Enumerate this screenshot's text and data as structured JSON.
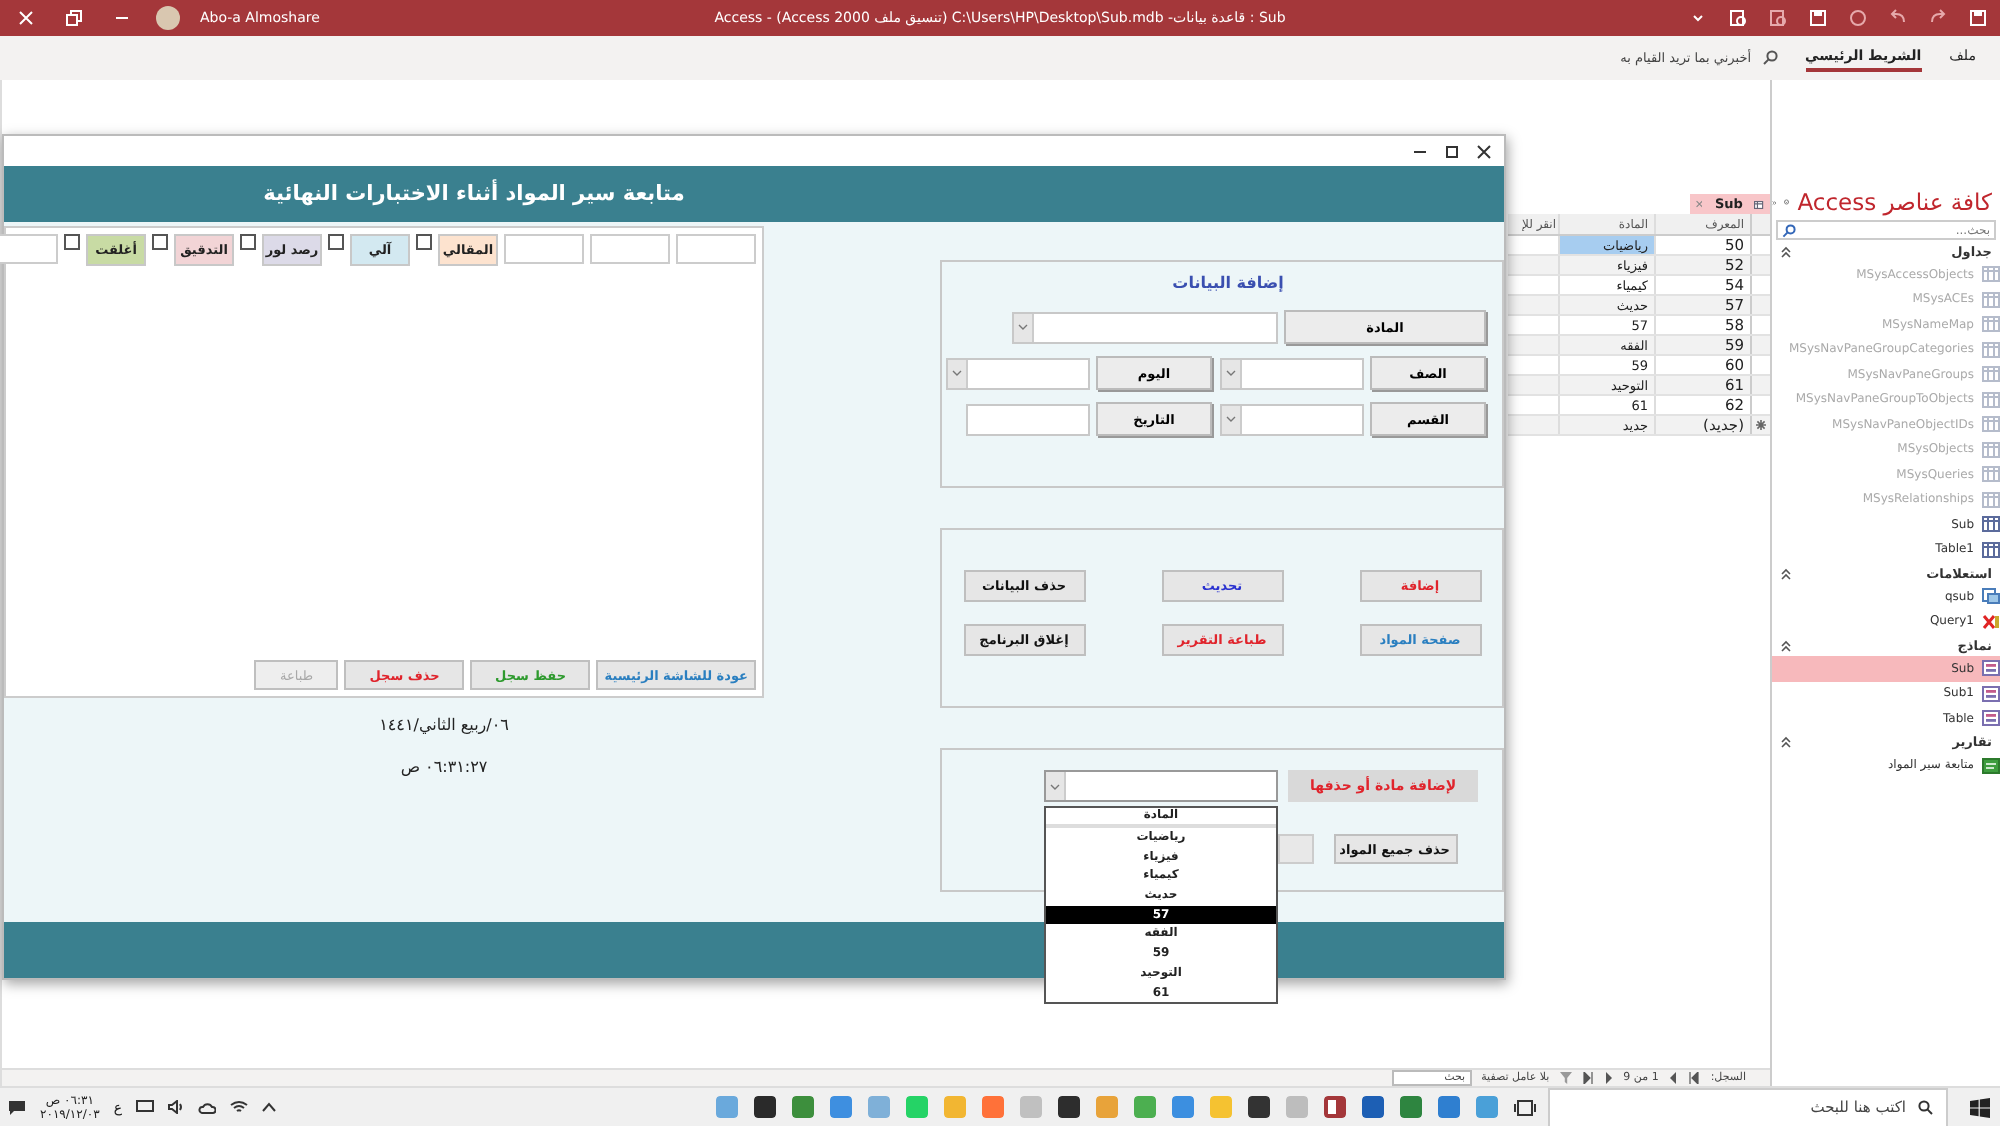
{
  "window": {
    "title": "Sub : قاعدة بيانات- C:\\Users\\HP\\Desktop\\Sub.mdb (تنسيق ملف Access 2000) - Access",
    "user": "Abo-a Almoshare"
  },
  "ribbon": {
    "tabs": [
      {
        "label": "ملف",
        "selected": false
      },
      {
        "label": "الشريط الرئيسي",
        "selected": true
      }
    ],
    "tell_me": "أخبرني بما تريد القيام به"
  },
  "form": {
    "title": "متابعة سير المواد أثناء الاختبارات النهائية",
    "filters": [
      {
        "label": "المقالي",
        "color": "#fde3cf",
        "checked": false
      },
      {
        "label": "آلي",
        "color": "#d3e9f1",
        "checked": false
      },
      {
        "label": "رصد لور",
        "color": "#dcdae8",
        "checked": false
      },
      {
        "label": "التدقيق",
        "color": "#f2d4d6",
        "checked": false
      },
      {
        "label": "أغلقت",
        "color": "#c8dba4",
        "checked": false
      }
    ],
    "record_buttons": [
      {
        "label": "عودة للشاشة الرئيسية",
        "color": "#2a7fc0",
        "disabled": false
      },
      {
        "label": "حفظ سجل",
        "color": "#2e9a2e",
        "disabled": false
      },
      {
        "label": "حذف سجل",
        "color": "#e0242c",
        "disabled": false
      },
      {
        "label": "طباعة",
        "color": "#a8a8a8",
        "disabled": true
      }
    ],
    "hijri_date": "٠٦/ربيع الثاني/١٤٤١",
    "time": "٠٦:٣١:٢٧ ص",
    "data_entry": {
      "title": "إضافة البيانات",
      "rows": [
        {
          "fields": [
            {
              "label": "المادة",
              "kind": "combo"
            }
          ]
        },
        {
          "fields": [
            {
              "label": "الصف",
              "kind": "combo"
            },
            {
              "label": "اليوم",
              "kind": "combo"
            }
          ]
        },
        {
          "fields": [
            {
              "label": "القسم",
              "kind": "combo"
            },
            {
              "label": "التاريخ",
              "kind": "text"
            }
          ]
        }
      ]
    },
    "actions": [
      {
        "label": "إضافة",
        "color": "#e0242c"
      },
      {
        "label": "تحديث",
        "color": "#2a32d0"
      },
      {
        "label": "حذف البيانات",
        "color": "#111111"
      },
      {
        "label": "صفحة المواد",
        "color": "#2a7fc0"
      },
      {
        "label": "طباعة التقرير",
        "color": "#e0242c"
      },
      {
        "label": "إغلاق البرنامج",
        "color": "#111111"
      }
    ],
    "subjects": {
      "label": "لإضافة مادة أو حذفها",
      "delete_all": "حذف جميع المواد",
      "dropdown": {
        "header": "المادة",
        "options": [
          {
            "label": "رياضيات",
            "selected": false
          },
          {
            "label": "فيزياء",
            "selected": false
          },
          {
            "label": "كيمياء",
            "selected": false
          },
          {
            "label": "حديث",
            "selected": false
          },
          {
            "label": "57",
            "selected": true
          },
          {
            "label": "الفقه",
            "selected": false
          },
          {
            "label": "59",
            "selected": false
          },
          {
            "label": "التوحيد",
            "selected": false
          },
          {
            "label": "61",
            "selected": false
          }
        ]
      }
    }
  },
  "datasheet": {
    "tab": "Sub",
    "columns": [
      "المعرف",
      "المادة",
      "انقر للإ"
    ],
    "rows": [
      {
        "id": "50",
        "subject": "رياضيات",
        "selected": true
      },
      {
        "id": "52",
        "subject": "فيزياء",
        "selected": false
      },
      {
        "id": "54",
        "subject": "كيمياء",
        "selected": false
      },
      {
        "id": "57",
        "subject": "حديث",
        "selected": false
      },
      {
        "id": "58",
        "subject": "57",
        "selected": false
      },
      {
        "id": "59",
        "subject": "الفقه",
        "selected": false
      },
      {
        "id": "60",
        "subject": "59",
        "selected": false
      },
      {
        "id": "61",
        "subject": "التوحيد",
        "selected": false
      },
      {
        "id": "62",
        "subject": "61",
        "selected": false
      }
    ],
    "new_row": {
      "id": "(جديد)",
      "subject": "جديد"
    }
  },
  "status_bar": {
    "record_label": "السجل:",
    "record_position": "1 من 9",
    "filter": "بلا عامل تصفية",
    "search": "بحث"
  },
  "nav": {
    "title": "كافة عناصر Access",
    "search_placeholder": "بحث...",
    "groups": [
      {
        "label": "جداول",
        "items": [
          {
            "label": "MSysAccessObjects",
            "kind": "system-table",
            "selected": false
          },
          {
            "label": "MSysACEs",
            "kind": "system-table",
            "selected": false
          },
          {
            "label": "MSysNameMap",
            "kind": "system-table",
            "selected": false
          },
          {
            "label": "MSysNavPaneGroupCategories",
            "kind": "system-table",
            "selected": false
          },
          {
            "label": "MSysNavPaneGroups",
            "kind": "system-table",
            "selected": false
          },
          {
            "label": "MSysNavPaneGroupToObjects",
            "kind": "system-table",
            "selected": false
          },
          {
            "label": "MSysNavPaneObjectIDs",
            "kind": "system-table",
            "selected": false
          },
          {
            "label": "MSysObjects",
            "kind": "system-table",
            "selected": false
          },
          {
            "label": "MSysQueries",
            "kind": "system-table",
            "selected": false
          },
          {
            "label": "MSysRelationships",
            "kind": "system-table",
            "selected": false
          },
          {
            "label": "Sub",
            "kind": "table",
            "selected": false
          },
          {
            "label": "Table1",
            "kind": "table",
            "selected": false
          }
        ]
      },
      {
        "label": "استعلامات",
        "items": [
          {
            "label": "qsub",
            "kind": "query",
            "selected": false
          },
          {
            "label": "Query1",
            "kind": "broken-query",
            "selected": false
          }
        ]
      },
      {
        "label": "نماذج",
        "items": [
          {
            "label": "Sub",
            "kind": "form",
            "selected": true
          },
          {
            "label": "Sub1",
            "kind": "form",
            "selected": false
          },
          {
            "label": "Table",
            "kind": "form",
            "selected": false
          }
        ]
      },
      {
        "label": "تقارير",
        "items": [
          {
            "label": "متابعة سير المواد",
            "kind": "report",
            "selected": false
          }
        ]
      }
    ]
  },
  "taskbar": {
    "search_placeholder": "اكتب هنا للبحث",
    "language": "ع",
    "time": "٠٦:٣١ ص",
    "date": "٢٠١٩/١٢/٠٣"
  }
}
